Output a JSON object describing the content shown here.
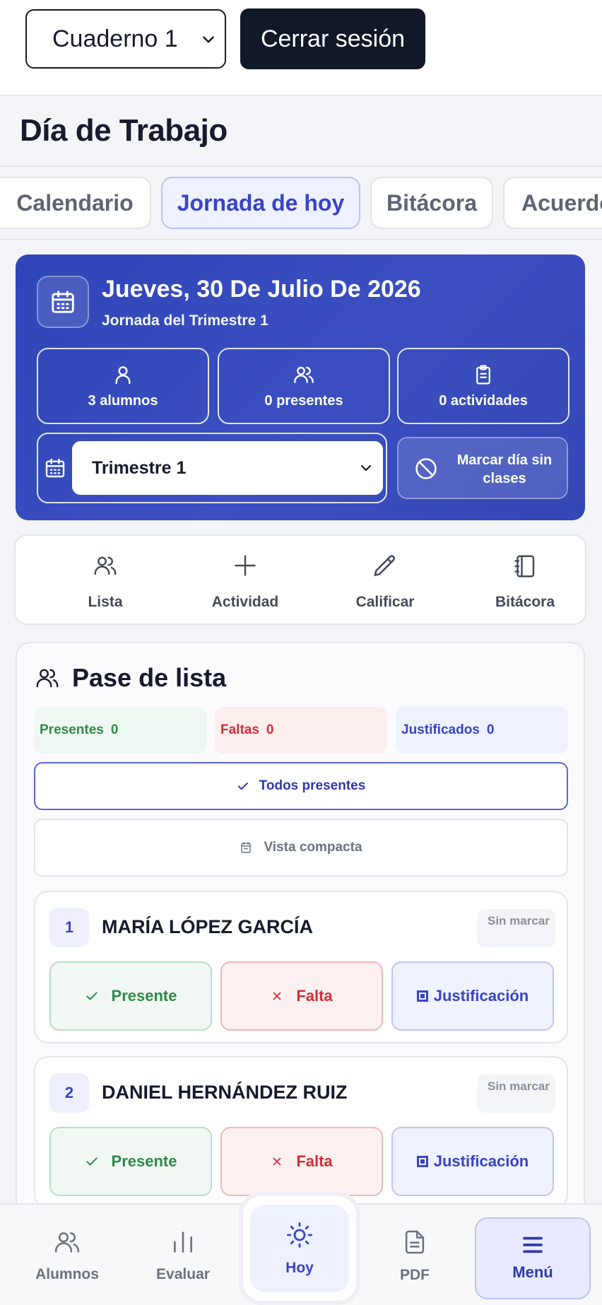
{
  "header": {
    "notebook_value": "Cuaderno 1",
    "logout_label": "Cerrar sesión"
  },
  "page": {
    "title": "Día de Trabajo"
  },
  "tabs": [
    {
      "label": "Calendario"
    },
    {
      "label": "Jornada de hoy"
    },
    {
      "label": "Bitácora"
    },
    {
      "label": "Acuerdo"
    }
  ],
  "hero": {
    "date": "Jueves, 30 De Julio De 2026",
    "subtitle": "Jornada del Trimestre 1",
    "stats": [
      {
        "label": "3 alumnos",
        "icon": "user-icon"
      },
      {
        "label": "0 presentes",
        "icon": "users-icon"
      },
      {
        "label": "0 actividades",
        "icon": "clipboard-icon"
      }
    ],
    "term_value": "Trimestre 1",
    "no_class_label": "Marcar día sin clases"
  },
  "quick_actions": [
    {
      "label": "Lista",
      "icon": "users-icon"
    },
    {
      "label": "Actividad",
      "icon": "plus-icon"
    },
    {
      "label": "Calificar",
      "icon": "pencil-icon"
    },
    {
      "label": "Bitácora",
      "icon": "notebook-icon"
    }
  ],
  "attendance": {
    "title": "Pase de lista",
    "counters": {
      "present_label": "Presentes",
      "present_value": "0",
      "absent_label": "Faltas",
      "absent_value": "0",
      "justified_label": "Justificados",
      "justified_value": "0"
    },
    "all_present_label": "Todos presentes",
    "compact_view_label": "Vista compacta",
    "students": [
      {
        "number": "1",
        "name": "MARÍA LÓPEZ GARCÍA",
        "status": "Sin marcar"
      },
      {
        "number": "2",
        "name": "DANIEL HERNÁNDEZ RUIZ",
        "status": "Sin marcar"
      }
    ],
    "buttons": {
      "present": "Presente",
      "absent": "Falta",
      "justification": "Justificación"
    }
  },
  "bottom_nav": {
    "students": "Alumnos",
    "evaluate": "Evaluar",
    "today": "Hoy",
    "pdf": "PDF",
    "menu": "Menú"
  },
  "colors": {
    "primary": "#3843c7",
    "hero_bg": "#3447b5",
    "present": "#2f8a4a",
    "absent": "#d12f37",
    "dark": "#111827"
  }
}
